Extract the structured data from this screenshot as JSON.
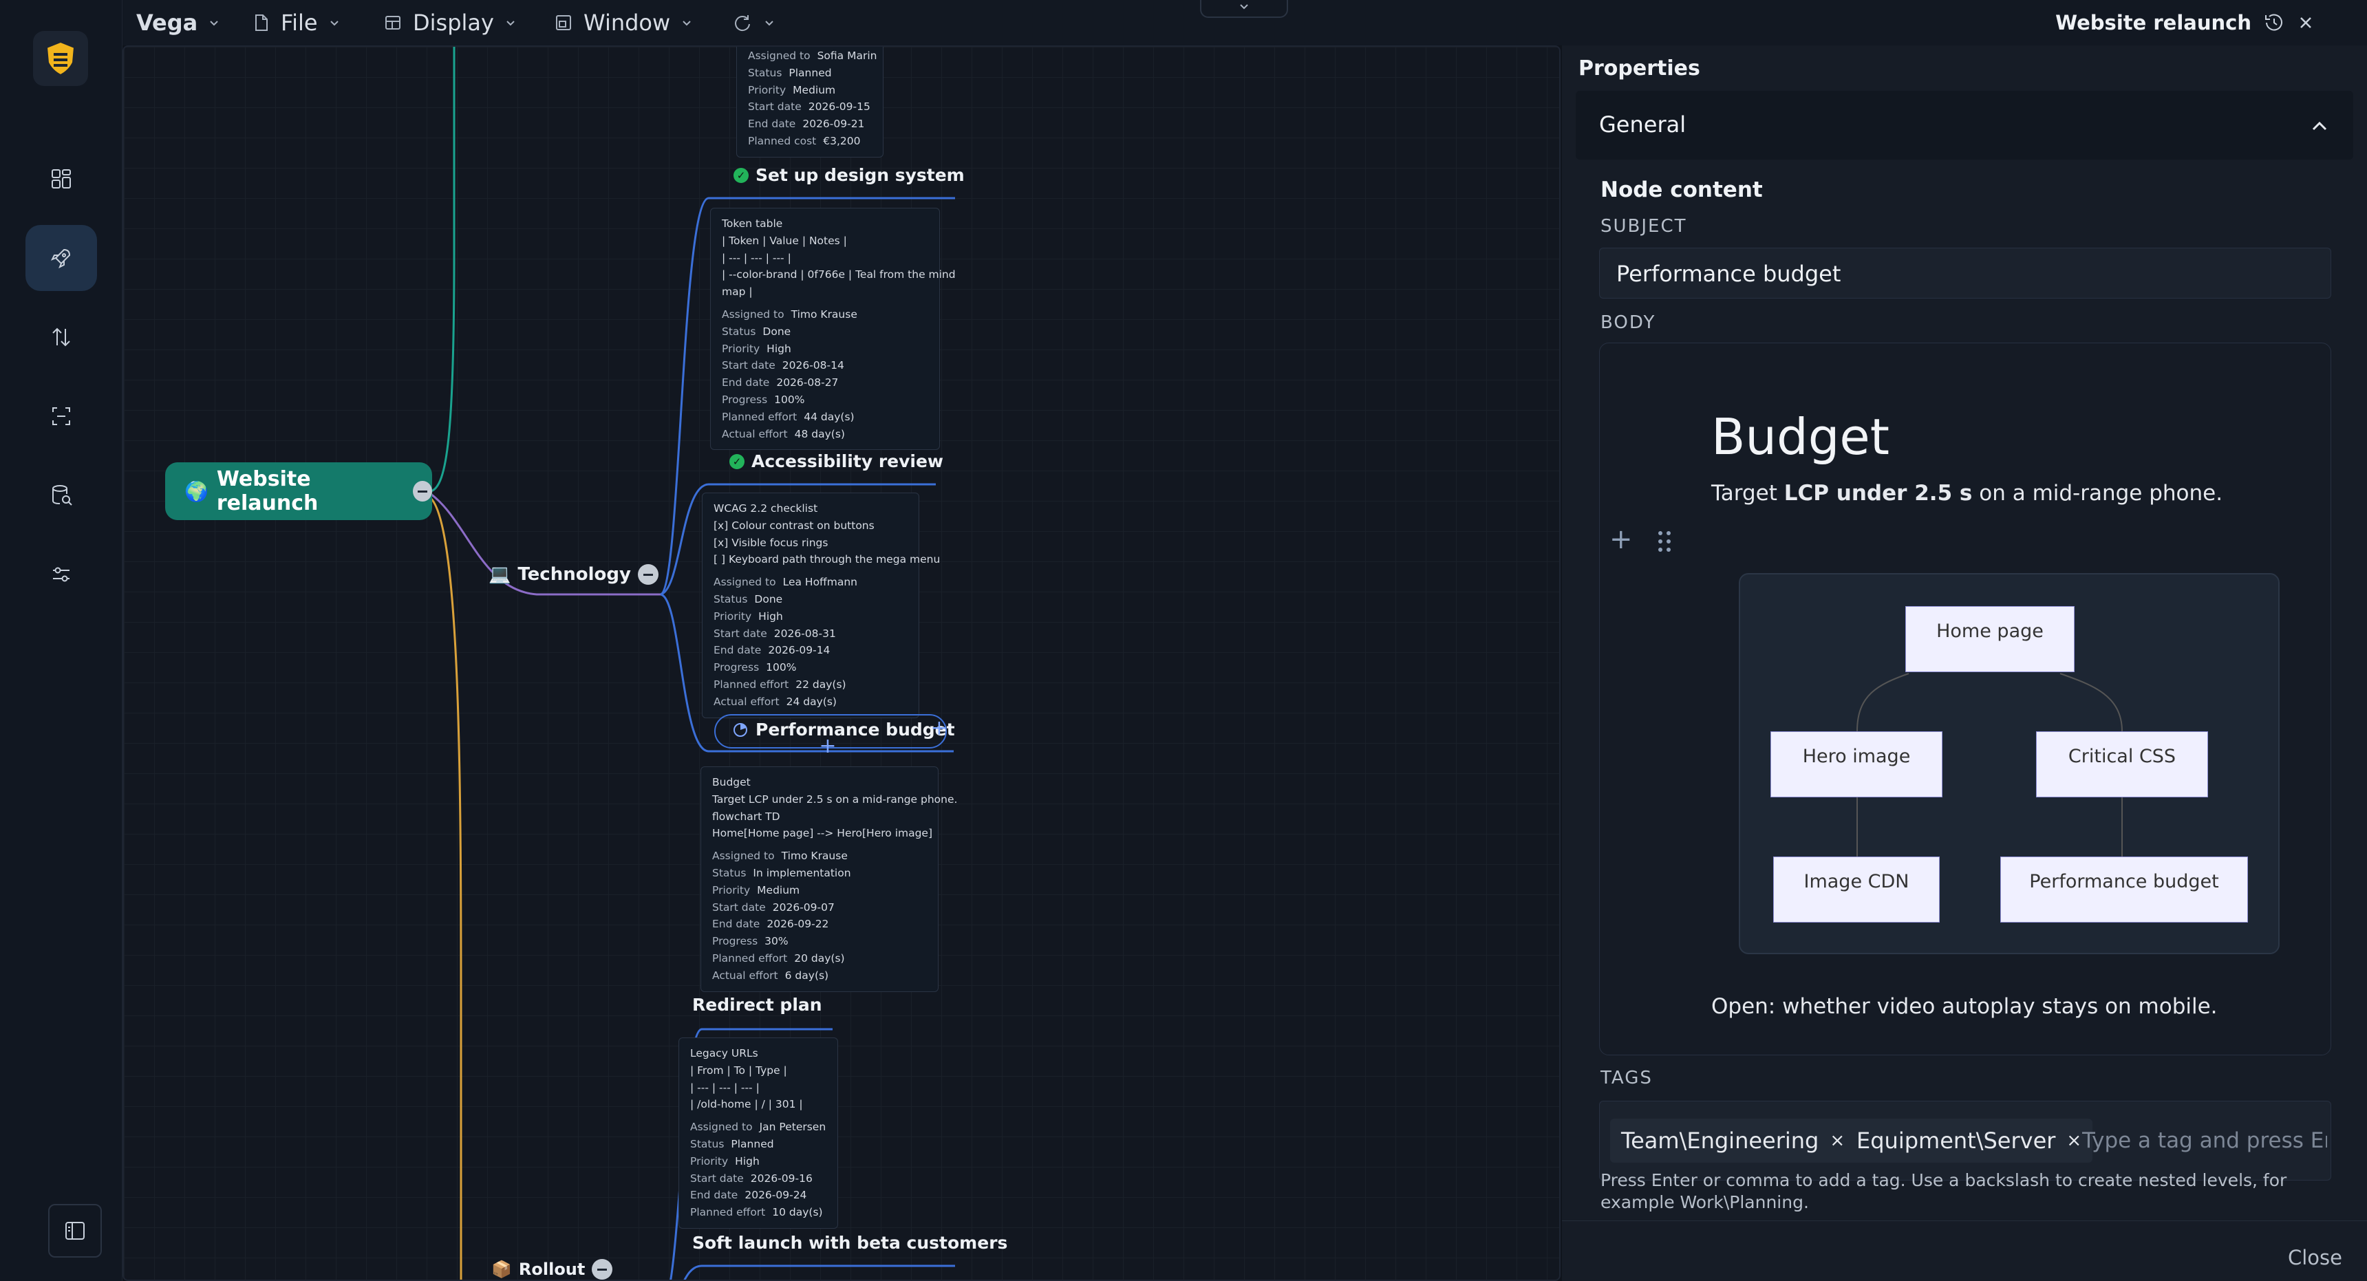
{
  "app": {
    "name": "Vega"
  },
  "menus": {
    "file": "File",
    "display": "Display",
    "window": "Window"
  },
  "document": {
    "title": "Website relaunch"
  },
  "mindmap": {
    "root": {
      "label": "Website relaunch",
      "icon": "globe-icon"
    },
    "branches": {
      "technology": "Technology",
      "rollout": "Rollout"
    },
    "nodes": {
      "design_system": "Set up design system",
      "accessibility": "Accessibility review",
      "performance": "Performance budget",
      "redirect": "Redirect plan",
      "soft_launch": "Soft launch with beta customers"
    },
    "cards": {
      "top": {
        "lines": [],
        "fields": [
          {
            "k": "Assigned to",
            "v": "Sofia Marin"
          },
          {
            "k": "Status",
            "v": "Planned"
          },
          {
            "k": "Priority",
            "v": "Medium"
          },
          {
            "k": "Start date",
            "v": "2026-09-15"
          },
          {
            "k": "End date",
            "v": "2026-09-21"
          },
          {
            "k": "Planned cost",
            "v": "€3,200"
          }
        ]
      },
      "design_system": {
        "lines": [
          "Token table",
          "| Token | Value | Notes |",
          "| --- | --- | --- |",
          "| --color-brand | 0f766e | Teal from the mind",
          "map |"
        ],
        "fields": [
          {
            "k": "Assigned to",
            "v": "Timo Krause"
          },
          {
            "k": "Status",
            "v": "Done"
          },
          {
            "k": "Priority",
            "v": "High"
          },
          {
            "k": "Start date",
            "v": "2026-08-14"
          },
          {
            "k": "End date",
            "v": "2026-08-27"
          },
          {
            "k": "Progress",
            "v": "100%"
          },
          {
            "k": "Planned effort",
            "v": "44 day(s)"
          },
          {
            "k": "Actual effort",
            "v": "48 day(s)"
          }
        ]
      },
      "accessibility": {
        "lines": [
          "WCAG 2.2 checklist",
          "[x] Colour contrast on buttons",
          "[x] Visible focus rings",
          "[ ] Keyboard path through the mega menu"
        ],
        "fields": [
          {
            "k": "Assigned to",
            "v": "Lea Hoffmann"
          },
          {
            "k": "Status",
            "v": "Done"
          },
          {
            "k": "Priority",
            "v": "High"
          },
          {
            "k": "Start date",
            "v": "2026-08-31"
          },
          {
            "k": "End date",
            "v": "2026-09-14"
          },
          {
            "k": "Progress",
            "v": "100%"
          },
          {
            "k": "Planned effort",
            "v": "22 day(s)"
          },
          {
            "k": "Actual effort",
            "v": "24 day(s)"
          }
        ]
      },
      "performance": {
        "lines": [
          "Budget",
          "Target LCP under 2.5 s on a mid-range phone.",
          "flowchart TD",
          "Home[Home page] --> Hero[Hero image]"
        ],
        "fields": [
          {
            "k": "Assigned to",
            "v": "Timo Krause"
          },
          {
            "k": "Status",
            "v": "In implementation"
          },
          {
            "k": "Priority",
            "v": "Medium"
          },
          {
            "k": "Start date",
            "v": "2026-09-07"
          },
          {
            "k": "End date",
            "v": "2026-09-22"
          },
          {
            "k": "Progress",
            "v": "30%"
          },
          {
            "k": "Planned effort",
            "v": "20 day(s)"
          },
          {
            "k": "Actual effort",
            "v": "6 day(s)"
          }
        ]
      },
      "redirect": {
        "lines": [
          "Legacy URLs",
          "| From | To | Type |",
          "| --- | --- | --- |",
          "| /old-home | / | 301 |"
        ],
        "fields": [
          {
            "k": "Assigned to",
            "v": "Jan Petersen"
          },
          {
            "k": "Status",
            "v": "Planned"
          },
          {
            "k": "Priority",
            "v": "High"
          },
          {
            "k": "Start date",
            "v": "2026-09-16"
          },
          {
            "k": "End date",
            "v": "2026-09-24"
          },
          {
            "k": "Planned effort",
            "v": "10 day(s)"
          }
        ]
      }
    }
  },
  "properties": {
    "title": "Properties",
    "section": "General",
    "node_content": "Node content",
    "subject_label": "SUBJECT",
    "subject_value": "Performance budget",
    "body_label": "BODY",
    "body": {
      "heading": "Budget",
      "target_prefix": "Target ",
      "target_bold": "LCP under 2.5 s",
      "target_suffix": " on a mid-range phone.",
      "open_note": "Open: whether video autoplay stays on mobile.",
      "diagram": {
        "home": "Home page",
        "hero": "Hero image",
        "critical": "Critical CSS",
        "cdn": "Image CDN",
        "perf": "Performance budget"
      }
    },
    "tags_label": "TAGS",
    "tags": [
      "Team\\Engineering",
      "Equipment\\Server"
    ],
    "tag_placeholder": "Type a tag and press Enter",
    "hint": "Press Enter or comma to add a tag. Use a backslash to create nested levels, for example Work\\Planning.",
    "close": "Close"
  },
  "colors": {
    "root": "#147a6a",
    "branch_teal": "#1aa38f",
    "branch_purple": "#8c6cc7",
    "branch_orange": "#d9a13a",
    "link_blue": "#3b6fd8",
    "done": "#22b35a"
  }
}
